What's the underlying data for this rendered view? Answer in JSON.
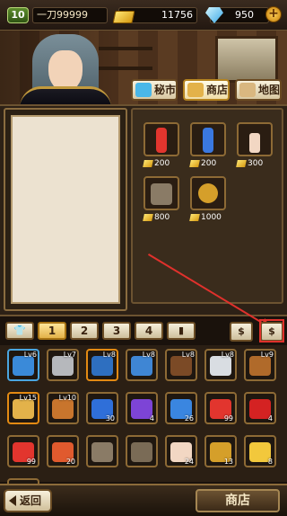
{
  "player": {
    "level": "10",
    "name": "一刀99999"
  },
  "currency": {
    "gold": "11756",
    "gems": "950",
    "plus_label": "+"
  },
  "nav": [
    {
      "label": "秘市",
      "icon": "diamond-icon",
      "color": "#4ab7e8"
    },
    {
      "label": "商店",
      "icon": "gold-bars-icon",
      "color": "#e3b24a"
    },
    {
      "label": "地图",
      "icon": "map-icon",
      "color": "#d9b780"
    }
  ],
  "cart_items": [
    {
      "icon": "red-potion-icon",
      "price": "200",
      "color": "#e2352e"
    },
    {
      "icon": "blue-potion-icon",
      "price": "200",
      "color": "#3a78e0"
    },
    {
      "icon": "candle-icon",
      "price": "300",
      "color": "#f2d7c3"
    },
    {
      "icon": "pickaxe-icon",
      "price": "800",
      "color": "#8a7b66"
    },
    {
      "icon": "compass-icon",
      "price": "1000",
      "color": "#d59f2a"
    }
  ],
  "tabs": [
    {
      "label": "👕",
      "name": "tab-equipment"
    },
    {
      "label": "1",
      "name": "tab-1"
    },
    {
      "label": "2",
      "name": "tab-2"
    },
    {
      "label": "3",
      "name": "tab-3"
    },
    {
      "label": "4",
      "name": "tab-4"
    },
    {
      "label": "▮",
      "name": "tab-book"
    }
  ],
  "sell_buttons": [
    {
      "label": "$",
      "name": "sell-button"
    },
    {
      "label": "$",
      "name": "sell-all-button"
    }
  ],
  "inventory": [
    {
      "icon": "blue-sword-icon",
      "lv": "Lv6",
      "cnt": "",
      "color": "#3a8ad9",
      "rarity": "blue"
    },
    {
      "icon": "armor-icon",
      "lv": "Lv7",
      "cnt": "",
      "color": "#b6b8bc",
      "rarity": ""
    },
    {
      "icon": "blue-pants-icon",
      "lv": "Lv8",
      "cnt": "",
      "color": "#2e6fc0",
      "rarity": "orange"
    },
    {
      "icon": "blue-pants-icon",
      "lv": "Lv8",
      "cnt": "",
      "color": "#3f86d4",
      "rarity": ""
    },
    {
      "icon": "gloves-icon",
      "lv": "Lv8",
      "cnt": "",
      "color": "#7b4a26",
      "rarity": ""
    },
    {
      "icon": "boots-icon",
      "lv": "Lv8",
      "cnt": "",
      "color": "#d9dde2",
      "rarity": ""
    },
    {
      "icon": "bag-icon",
      "lv": "Lv9",
      "cnt": "",
      "color": "#b06a2a",
      "rarity": ""
    },
    {
      "icon": "ring-icon",
      "lv": "Lv15",
      "cnt": "",
      "color": "#e3b24a",
      "rarity": "orange"
    },
    {
      "icon": "necklace-icon",
      "lv": "Lv10",
      "cnt": "",
      "color": "#c8752d",
      "rarity": ""
    },
    {
      "icon": "blue-potion-icon",
      "lv": "",
      "cnt": "30",
      "color": "#2f6fd9",
      "rarity": ""
    },
    {
      "icon": "purple-potion-icon",
      "lv": "",
      "cnt": "4",
      "color": "#7d44d6",
      "rarity": ""
    },
    {
      "icon": "blue-potion-icon",
      "lv": "",
      "cnt": "26",
      "color": "#3a86e0",
      "rarity": ""
    },
    {
      "icon": "red-potion-icon",
      "lv": "",
      "cnt": "99",
      "color": "#e2352e",
      "rarity": ""
    },
    {
      "icon": "red-potion-icon",
      "lv": "",
      "cnt": "4",
      "color": "#d42222",
      "rarity": ""
    },
    {
      "icon": "red-potion-icon",
      "lv": "",
      "cnt": "99",
      "color": "#e2352e",
      "rarity": ""
    },
    {
      "icon": "red-potion-icon",
      "lv": "",
      "cnt": "20",
      "color": "#e05a2e",
      "rarity": ""
    },
    {
      "icon": "pickaxe-icon",
      "lv": "",
      "cnt": "",
      "color": "#8a7b66",
      "rarity": ""
    },
    {
      "icon": "pickaxe-icon",
      "lv": "",
      "cnt": "",
      "color": "#7a6b56",
      "rarity": ""
    },
    {
      "icon": "candle-icon",
      "lv": "",
      "cnt": "24",
      "color": "#f2d7c3",
      "rarity": ""
    },
    {
      "icon": "compass-icon",
      "lv": "",
      "cnt": "13",
      "color": "#d59f2a",
      "rarity": ""
    },
    {
      "icon": "scroll-icon",
      "lv": "",
      "cnt": "8",
      "color": "#f2c83c",
      "rarity": ""
    },
    {
      "icon": "gem-box-icon",
      "lv": "",
      "cnt": "",
      "color": "#b5322e",
      "rarity": ""
    }
  ],
  "bottom": {
    "back_label": "返回",
    "title": "商店"
  }
}
